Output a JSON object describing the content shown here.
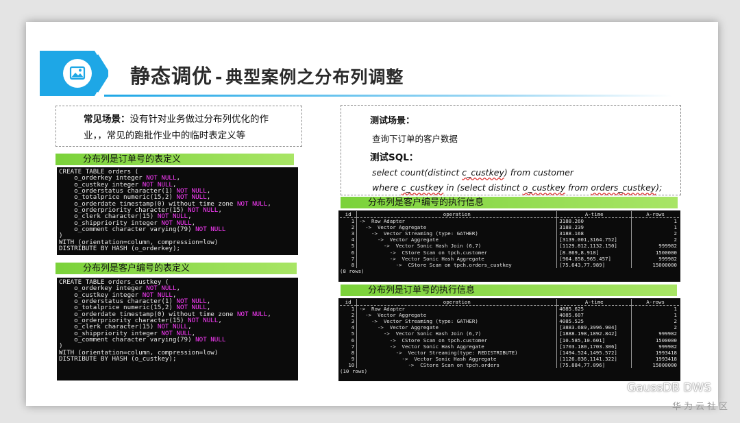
{
  "title": {
    "part1": "静态调优",
    "separator": "-",
    "part2": "典型案例之分布列调整"
  },
  "scene_left": {
    "label": "常见场景：",
    "text1": "没有针对业务做过分布列优化的作",
    "text2": "业，，常见的跑批作业中的临时表定义等"
  },
  "scene_right": {
    "label": "测试场景：",
    "desc": "查询下订单的客户数据",
    "sql_label": "测试SQL：",
    "sql_line1": "select count(distinct c_custkey) from customer",
    "sql_line2": "where c_custkey in (select distinct o_custkey from orders_custkey);"
  },
  "sections": {
    "def_orderkey": "分布列是订单号的表定义",
    "def_custkey": "分布列是客户编号的表定义",
    "plan_custkey": "分布列是客户编号的执行信息",
    "plan_orderkey": "分布列是订单号的执行信息"
  },
  "ddl_orders": [
    {
      "t": "CREATE TABLE orders (",
      "k": ""
    },
    {
      "t": "    o_orderkey integer ",
      "k": "NOT NULL",
      "e": ","
    },
    {
      "t": "    o_custkey integer ",
      "k": "NOT NULL",
      "e": ","
    },
    {
      "t": "    o_orderstatus character(1) ",
      "k": "NOT NULL",
      "e": ","
    },
    {
      "t": "    o_totalprice numeric(15,2) ",
      "k": "NOT NULL",
      "e": ","
    },
    {
      "t": "    o_orderdate timestamp(0) without time zone ",
      "k": "NOT NULL",
      "e": ","
    },
    {
      "t": "    o_orderpriority character(15) ",
      "k": "NOT NULL",
      "e": ","
    },
    {
      "t": "    o_clerk character(15) ",
      "k": "NOT NULL",
      "e": ","
    },
    {
      "t": "    o_shippriority integer ",
      "k": "NOT NULL",
      "e": ","
    },
    {
      "t": "    o_comment character varying(79) ",
      "k": "NOT NULL",
      "e": ""
    },
    {
      "t": ")",
      "k": ""
    },
    {
      "t": "WITH (orientation=column, compression=low)",
      "k": ""
    },
    {
      "t": "DISTRIBUTE BY HASH (o_orderkey);",
      "k": ""
    }
  ],
  "ddl_orders_custkey": [
    {
      "t": "CREATE TABLE orders_custkey (",
      "k": ""
    },
    {
      "t": "    o_orderkey integer ",
      "k": "NOT NULL",
      "e": ","
    },
    {
      "t": "    o_custkey integer ",
      "k": "NOT NULL",
      "e": ","
    },
    {
      "t": "    o_orderstatus character(1) ",
      "k": "NOT NULL",
      "e": ","
    },
    {
      "t": "    o_totalprice numeric(15,2) ",
      "k": "NOT NULL",
      "e": ","
    },
    {
      "t": "    o_orderdate timestamp(0) without time zone ",
      "k": "NOT NULL",
      "e": ","
    },
    {
      "t": "    o_orderpriority character(15) ",
      "k": "NOT NULL",
      "e": ","
    },
    {
      "t": "    o_clerk character(15) ",
      "k": "NOT NULL",
      "e": ","
    },
    {
      "t": "    o_shippriority integer ",
      "k": "NOT NULL",
      "e": ","
    },
    {
      "t": "    o_comment character varying(79) ",
      "k": "NOT NULL",
      "e": ""
    },
    {
      "t": ")",
      "k": ""
    },
    {
      "t": "WITH (orientation=column, compression=low)",
      "k": ""
    },
    {
      "t": "DISTRIBUTE BY HASH (o_custkey);",
      "k": ""
    }
  ],
  "plan_headers": [
    "id",
    "operation",
    "A-time",
    "A-rows"
  ],
  "plan_custkey": {
    "rows": [
      [
        "1",
        "->  Row Adapter",
        "3188.260",
        "1"
      ],
      [
        "2",
        "  ->  Vector Aggregate",
        "3188.239",
        "1"
      ],
      [
        "3",
        "    ->  Vector Streaming (type: GATHER)",
        "3188.168",
        "2"
      ],
      [
        "4",
        "      ->  Vector Aggregate",
        "[3139.001,3164.752]",
        "2"
      ],
      [
        "5",
        "        ->  Vector Sonic Hash Join (6,7)",
        "[1129.812,1132.150]",
        "999982"
      ],
      [
        "6",
        "          ->  CStore Scan on tpch.customer",
        "[8.869,8.918]",
        "1500000"
      ],
      [
        "7",
        "          ->  Vector Sonic Hash Aggregate",
        "[964.858,965.457]",
        "999982"
      ],
      [
        "8",
        "            ->  CStore Scan on tpch.orders_custkey",
        "[75.643,77.989]",
        "15000000"
      ]
    ],
    "footer": "(8 rows)"
  },
  "plan_orderkey": {
    "rows": [
      [
        "1",
        "->  Row Adapter",
        "4085.625",
        "1"
      ],
      [
        "2",
        "  ->  Vector Aggregate",
        "4085.607",
        "1"
      ],
      [
        "3",
        "    ->  Vector Streaming (type: GATHER)",
        "4085.525",
        "2"
      ],
      [
        "4",
        "      ->  Vector Aggregate",
        "[3883.689,3996.904]",
        "2"
      ],
      [
        "5",
        "        ->  Vector Sonic Hash Join (6,7)",
        "[1888.198,1892.842]",
        "999982"
      ],
      [
        "6",
        "          ->  CStore Scan on tpch.customer",
        "[10.585,10.601]",
        "1500000"
      ],
      [
        "7",
        "          ->  Vector Sonic Hash Aggregate",
        "[1703.180,1703.306]",
        "999982"
      ],
      [
        "8",
        "            ->  Vector Streaming(type: REDISTRIBUTE)",
        "[1494.524,1495.572]",
        "1993418"
      ],
      [
        "9",
        "              ->  Vector Sonic Hash Aggregate",
        "[1126.836,1141.322]",
        "1993418"
      ],
      [
        "10",
        "                ->  CStore Scan on tpch.orders",
        "[75.884,77.096]",
        "15000000"
      ]
    ],
    "footer": "(10 rows)"
  },
  "watermark": {
    "brand": "GaussDB DWS",
    "community": "华为云社区"
  },
  "colors": {
    "accent": "#1ea7e6",
    "green_bar": "#7bd23a",
    "keyword": "#ff3cff",
    "terminal_bg": "#0b0b0b"
  }
}
